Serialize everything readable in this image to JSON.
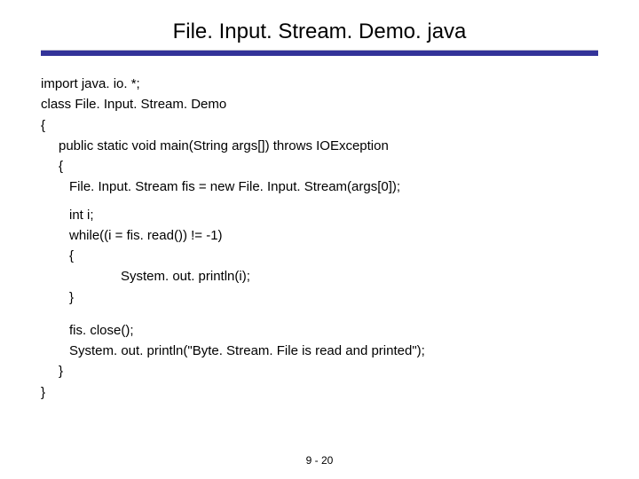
{
  "title": "File. Input. Stream. Demo. java",
  "code": {
    "l1": "import java. io. *;",
    "l2": "class File. Input. Stream. Demo",
    "l3": "{",
    "l4": "public static void main(String args[]) throws IOException",
    "l5": "{",
    "l6": "File. Input. Stream fis = new File. Input. Stream(args[0]);",
    "l7": "int i;",
    "l8": "while((i = fis. read()) != -1)",
    "l9": "{",
    "l10": "System. out. println(i);",
    "l11": "}",
    "l12": "fis. close();",
    "l13": "System. out. println(\"Byte. Stream. File is read and printed\");",
    "l14": "}",
    "l15": "}"
  },
  "footer": "9 - 20"
}
